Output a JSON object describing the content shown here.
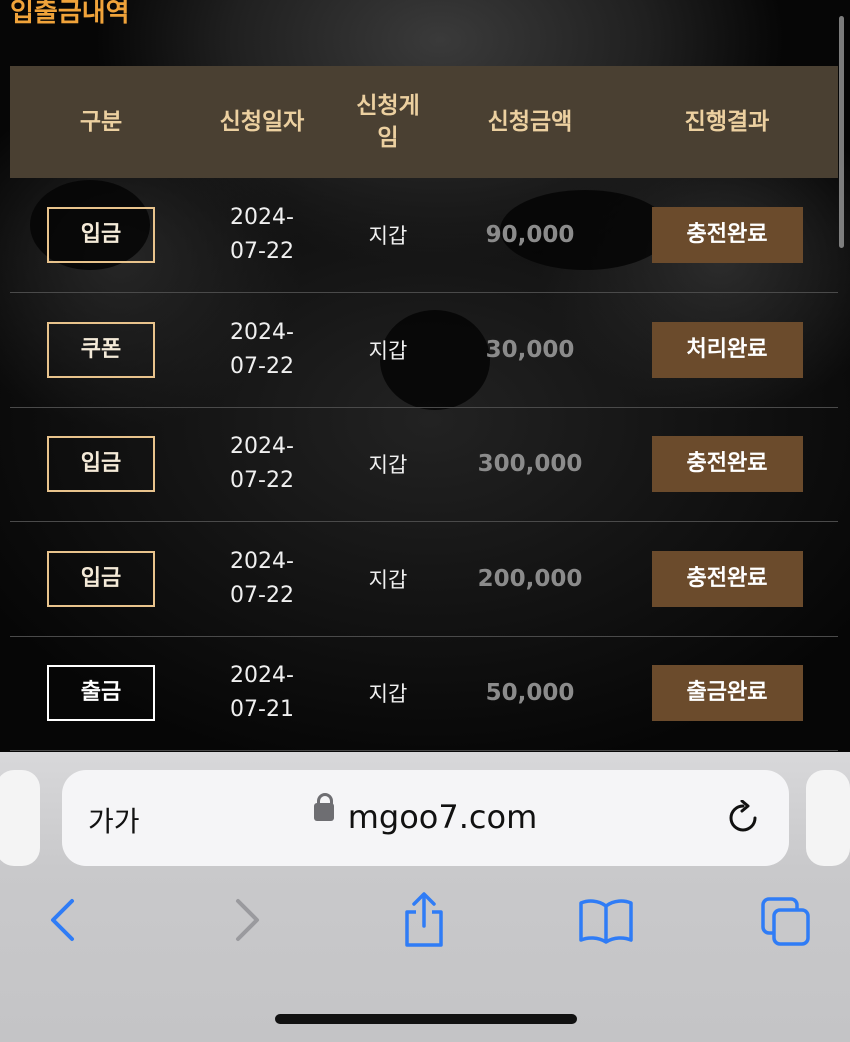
{
  "section": {
    "title": "입출금내역"
  },
  "table": {
    "headers": [
      "구분",
      "신청일자",
      "신청게임",
      "신청금액",
      "진행결과"
    ],
    "headers_display": {
      "game_line1": "신청게",
      "game_line2": "임"
    },
    "rows": [
      {
        "type": "입금",
        "date_year": "2024-",
        "date_md": "07-22",
        "game": "지갑",
        "amount": "90,000",
        "status": "충전완료"
      },
      {
        "type": "쿠폰",
        "date_year": "2024-",
        "date_md": "07-22",
        "game": "지갑",
        "amount": "30,000",
        "status": "처리완료"
      },
      {
        "type": "입금",
        "date_year": "2024-",
        "date_md": "07-22",
        "game": "지갑",
        "amount": "300,000",
        "status": "충전완료"
      },
      {
        "type": "입금",
        "date_year": "2024-",
        "date_md": "07-22",
        "game": "지갑",
        "amount": "200,000",
        "status": "충전완료"
      },
      {
        "type": "출금",
        "date_year": "2024-",
        "date_md": "07-21",
        "game": "지갑",
        "amount": "50,000",
        "status": "출금완료"
      }
    ]
  },
  "browser": {
    "text_size_label": "가가",
    "url": "mgoo7.com"
  },
  "colors": {
    "title": "#f0a33a",
    "header_bg": "#4a4032",
    "header_text": "#ecd0a0",
    "status_bg": "#6b4b2c",
    "badge_border": "#e8c38c",
    "ios_blue": "#2f7cf6"
  },
  "icons": [
    "lock-icon",
    "reload-icon",
    "back-icon",
    "forward-icon",
    "share-icon",
    "bookmarks-icon",
    "tabs-icon"
  ]
}
